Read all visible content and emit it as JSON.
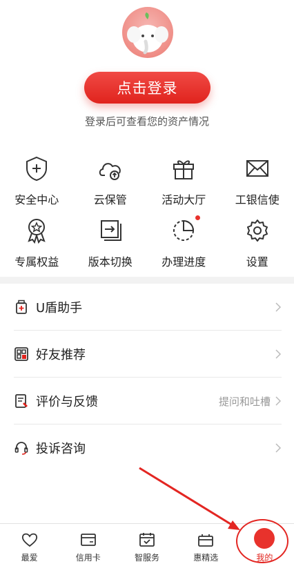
{
  "header": {
    "login_button": "点击登录",
    "login_hint": "登录后可查看您的资产情况"
  },
  "grid": {
    "row1": [
      {
        "label": "安全中心",
        "icon": "shield-plus-icon"
      },
      {
        "label": "云保管",
        "icon": "cloud-upload-icon"
      },
      {
        "label": "活动大厅",
        "icon": "gift-icon"
      },
      {
        "label": "工银信使",
        "icon": "envelope-icon"
      }
    ],
    "row2": [
      {
        "label": "专属权益",
        "icon": "medal-icon"
      },
      {
        "label": "版本切换",
        "icon": "switch-icon"
      },
      {
        "label": "办理进度",
        "icon": "progress-icon"
      },
      {
        "label": "设置",
        "icon": "gear-icon"
      }
    ]
  },
  "menu": [
    {
      "label": "U盾助手",
      "icon": "usb-key-icon",
      "right": ""
    },
    {
      "label": "好友推荐",
      "icon": "recommend-icon",
      "right": ""
    },
    {
      "label": "评价与反馈",
      "icon": "feedback-icon",
      "right": "提问和吐槽"
    },
    {
      "label": "投诉咨询",
      "icon": "headset-icon",
      "right": ""
    }
  ],
  "tabbar": [
    {
      "label": "最爱",
      "icon": "heart-icon"
    },
    {
      "label": "信用卡",
      "icon": "credit-card-icon"
    },
    {
      "label": "智服务",
      "icon": "calendar-check-icon"
    },
    {
      "label": "惠精选",
      "icon": "bag-icon"
    },
    {
      "label": "我的",
      "icon": "me-icon",
      "active": true
    }
  ],
  "colors": {
    "accent": "#e0231d",
    "divider": "#f2f2f2"
  }
}
